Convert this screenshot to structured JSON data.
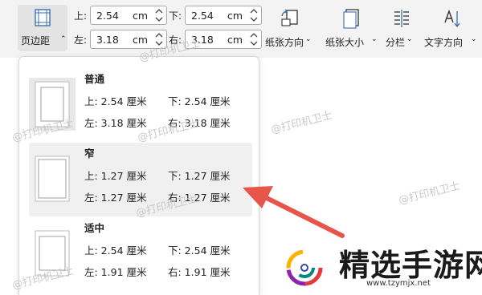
{
  "ribbon": {
    "margins_button_label": "页边距",
    "top_label": "上:",
    "top_value": "2.54",
    "bottom_label": "下:",
    "bottom_value": "2.54",
    "left_label": "左:",
    "left_value": "3.18",
    "right_label": "右:",
    "right_value": "3.18",
    "unit": "cm",
    "orientation_label": "纸张方向",
    "paper_size_label": "纸张大小",
    "columns_label": "分栏",
    "text_direction_label": "文字方向"
  },
  "presets": [
    {
      "name": "普通",
      "top": "上: 2.54 厘米",
      "bottom": "下: 2.54 厘米",
      "left": "左: 3.18 厘米",
      "right": "右: 3.18 厘米",
      "selected": false
    },
    {
      "name": "窄",
      "top": "上: 1.27 厘米",
      "bottom": "下: 1.27 厘米",
      "left": "左: 1.27 厘米",
      "right": "右: 1.27 厘米",
      "selected": true
    },
    {
      "name": "适中",
      "top": "上: 2.54 厘米",
      "bottom": "下: 2.54 厘米",
      "left": "左: 1.91 厘米",
      "right": "右: 1.91 厘米",
      "selected": false
    }
  ],
  "watermark": "@打印机卫士",
  "logo": {
    "title": "精选手游网",
    "url": "www.tzymjx.net"
  },
  "colors": {
    "arrow": "#e8554a",
    "highlight": "#f0f0f0",
    "ribbon_bg": "#f3f3f3"
  }
}
